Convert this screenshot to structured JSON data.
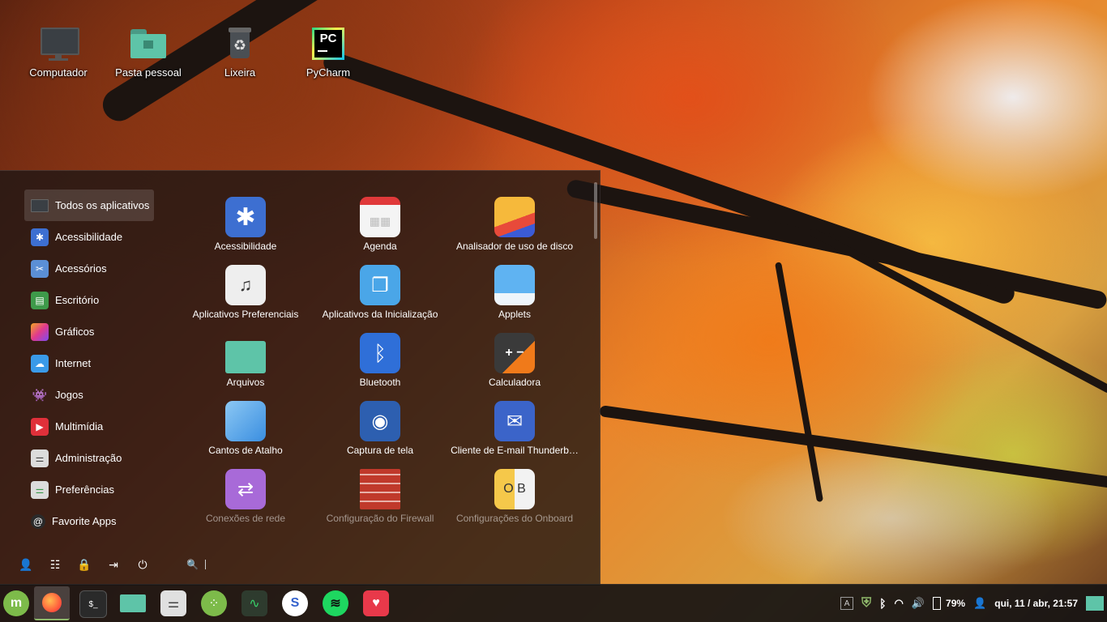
{
  "desktop": {
    "icons": [
      {
        "label": "Computador"
      },
      {
        "label": "Pasta pessoal"
      },
      {
        "label": "Lixeira"
      },
      {
        "label": "PyCharm"
      }
    ]
  },
  "menu": {
    "categories": [
      {
        "label": "Todos os aplicativos",
        "icon": "monitor-icon"
      },
      {
        "label": "Acessibilidade",
        "icon": "accessibility-icon"
      },
      {
        "label": "Acessórios",
        "icon": "scissors-icon"
      },
      {
        "label": "Escritório",
        "icon": "office-icon"
      },
      {
        "label": "Gráficos",
        "icon": "graphics-icon"
      },
      {
        "label": "Internet",
        "icon": "cloud-icon"
      },
      {
        "label": "Jogos",
        "icon": "invader-icon"
      },
      {
        "label": "Multimídia",
        "icon": "play-icon"
      },
      {
        "label": "Administração",
        "icon": "toggles-icon"
      },
      {
        "label": "Preferências",
        "icon": "toggles-icon"
      },
      {
        "label": "Favorite Apps",
        "icon": "at-icon"
      }
    ],
    "apps": [
      {
        "label": "Acessibilidade"
      },
      {
        "label": "Agenda"
      },
      {
        "label": "Analisador de uso de disco"
      },
      {
        "label": "Aplicativos Preferenciais"
      },
      {
        "label": "Aplicativos da Inicialização"
      },
      {
        "label": "Applets"
      },
      {
        "label": "Arquivos"
      },
      {
        "label": "Bluetooth"
      },
      {
        "label": "Calculadora"
      },
      {
        "label": "Cantos de Atalho"
      },
      {
        "label": "Captura de tela"
      },
      {
        "label": "Cliente de E-mail Thunderb…"
      },
      {
        "label": "Conexões de rede"
      },
      {
        "label": "Configuração do Firewall"
      },
      {
        "label": "Configurações do Onboard"
      }
    ],
    "search_placeholder": "",
    "accent": "#3d6fd1"
  },
  "taskbar": {
    "apps": [
      "mint-menu-icon",
      "firefox-icon",
      "terminal-icon",
      "files-icon",
      "settings-icon",
      "grid-icon",
      "monitor-graph-icon",
      "simplenote-icon",
      "spotify-icon",
      "heart-icon"
    ],
    "tray": {
      "keyboard": "A",
      "battery": "79%",
      "datetime": "qui, 11 / abr, 21:57"
    }
  }
}
